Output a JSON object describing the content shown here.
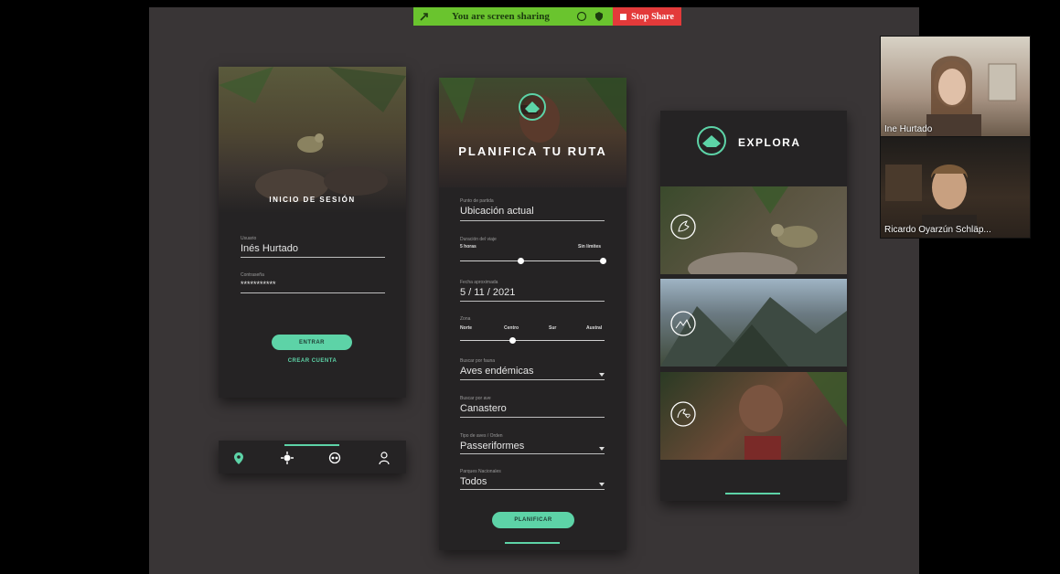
{
  "share_bar": {
    "text": "You are screen sharing",
    "stop_label": "Stop Share"
  },
  "login_screen": {
    "title": "INICIO DE SESIÓN",
    "user_label": "Usuario",
    "user_value": "Inés Hurtado",
    "password_label": "Contraseña",
    "password_value": "***********",
    "enter_button": "ENTRAR",
    "create_account_link": "CREAR CUENTA"
  },
  "bottom_nav": {
    "items": [
      "location-pin-icon",
      "compass-icon",
      "binoculars-icon",
      "user-icon"
    ]
  },
  "plan_screen": {
    "title": "PLANIFICA TU RUTA",
    "start_label": "Punto de partida",
    "start_value": "Ubicación actual",
    "duration_label": "Duración del viaje",
    "duration_min": "5 horas",
    "duration_max": "Sin límites",
    "date_label": "Fecha aproximada",
    "date_value": "5 / 11 / 2021",
    "zone_label": "Zona",
    "zones": [
      "Norte",
      "Centro",
      "Sur",
      "Austral"
    ],
    "fauna_label": "Buscar por fauna",
    "fauna_value": "Aves endémicas",
    "bird_label": "Buscar por ave",
    "bird_value": "Canastero",
    "type_label": "Tipo de aves / Orden",
    "type_value": "Passeriformes",
    "parks_label": "Parques Nacionales",
    "parks_value": "Todos",
    "plan_button": "PLANIFICAR"
  },
  "explore_screen": {
    "title": "EXPLORA"
  },
  "participants": [
    {
      "name": "Ine Hurtado"
    },
    {
      "name": "Ricardo Oyarzún Schläp..."
    }
  ],
  "colors": {
    "accent": "#5dd3a7",
    "share_green": "#6ac42e",
    "stop_red": "#e33a3a",
    "panel_bg": "#252324",
    "stage_bg": "#393536"
  }
}
